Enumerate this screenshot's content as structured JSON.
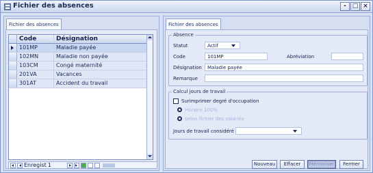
{
  "window": {
    "title": "Fichier des absences",
    "controls": [
      "-",
      "□",
      "×"
    ]
  },
  "left_panel": {
    "tab_label": "Fichier des absences",
    "columns": [
      "Code",
      "Désignation"
    ],
    "rows": [
      {
        "code": "101MP",
        "designation": "Maladie payée"
      },
      {
        "code": "102MN",
        "designation": "Maladie non payée"
      },
      {
        "code": "103CM",
        "designation": "Congé maternité"
      },
      {
        "code": "201VA",
        "designation": "Vacances"
      },
      {
        "code": "301AT",
        "designation": "Accident du travail"
      }
    ],
    "navigator": {
      "label": "Enregist",
      "current": "1"
    }
  },
  "right_panel": {
    "tab_label": "Fichier des absences",
    "absence_group": {
      "legend": "Absence",
      "statut_label": "Statut",
      "statut_value": "Actif",
      "code_label": "Code",
      "code_value": "101MP",
      "abreviation_label": "Abréviation",
      "abreviation_value": "",
      "designation_label": "Désignation",
      "designation_value": "Maladie payée",
      "remarque_label": "Remarque",
      "remarque_value": ""
    },
    "calcul_group": {
      "legend": "Calcul jours de travail",
      "checkbox_label": "Surimprimer degré d'occupation",
      "radio1_label": "Horaire 100%",
      "radio2_label": "selon fichier des salariés",
      "jours_label": "Jours de travail considéré",
      "jours_value": ""
    },
    "buttons": {
      "nouveau": "Nouveau",
      "effacer": "Effacer",
      "memoriser": "Mémoriser",
      "fermer": "Fermer"
    }
  },
  "colors": {
    "window_bg": "#d9e2f3",
    "selected_row": "#c8d6f1",
    "accent_border": "#7d94c6"
  },
  "icons": [
    "app-icon",
    "combo-arrow-icon",
    "current-record-arrow-icon",
    "nav-first-icon",
    "nav-prev-icon",
    "nav-next-icon",
    "nav-last-icon"
  ]
}
